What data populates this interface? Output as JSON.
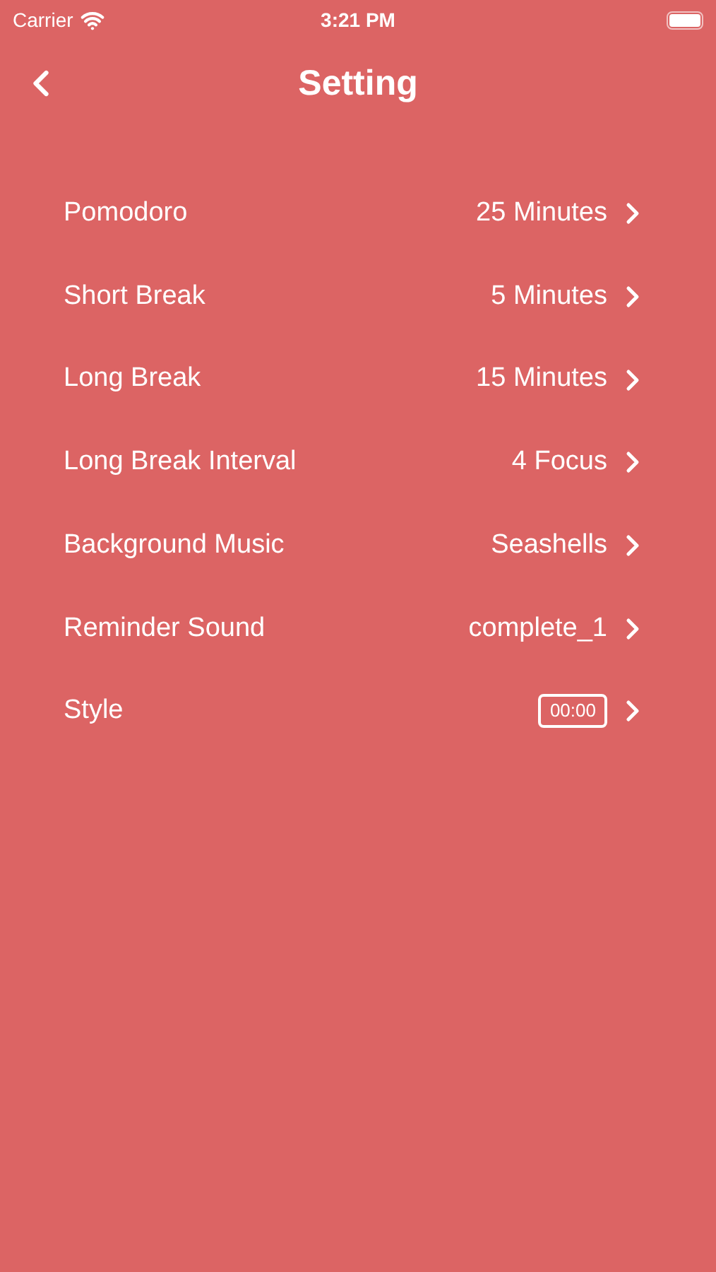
{
  "status_bar": {
    "carrier": "Carrier",
    "time": "3:21 PM"
  },
  "header": {
    "title": "Setting"
  },
  "settings": [
    {
      "kind": "text",
      "label": "Pomodoro",
      "value": "25 Minutes"
    },
    {
      "kind": "text",
      "label": "Short Break",
      "value": "5 Minutes"
    },
    {
      "kind": "text",
      "label": "Long Break",
      "value": "15 Minutes"
    },
    {
      "kind": "text",
      "label": "Long Break Interval",
      "value": "4 Focus"
    },
    {
      "kind": "text",
      "label": "Background Music",
      "value": "Seashells"
    },
    {
      "kind": "text",
      "label": "Reminder Sound",
      "value": "complete_1"
    },
    {
      "kind": "badge",
      "label": "Style",
      "value": "00:00"
    }
  ]
}
